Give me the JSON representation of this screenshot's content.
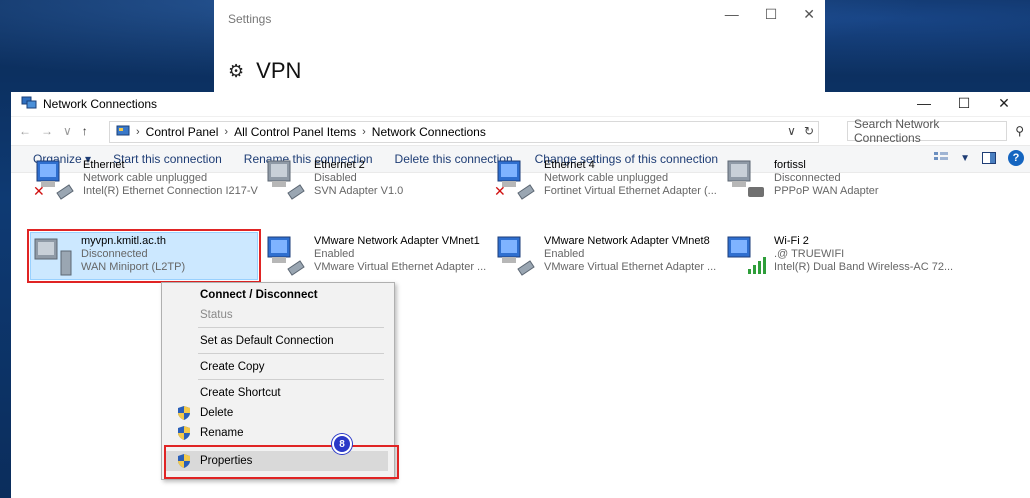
{
  "settings": {
    "title": "Settings",
    "heading": "VPN",
    "ctrl_min": "—",
    "ctrl_max": "☐",
    "ctrl_close": "✕"
  },
  "window": {
    "title": "Network Connections",
    "ctrl_min": "—",
    "ctrl_max": "☐",
    "ctrl_close": "✕"
  },
  "address": {
    "breadcrumbs": [
      "Control Panel",
      "All Control Panel Items",
      "Network Connections"
    ],
    "search_placeholder": "Search Network Connections"
  },
  "commands": {
    "organize": "Organize ▾",
    "start": "Start this connection",
    "rename": "Rename this connection",
    "delete": "Delete this connection",
    "change": "Change settings of this connection",
    "help": "?"
  },
  "connections": [
    {
      "name": "Ethernet",
      "status": "Network cable unplugged",
      "adapter": "Intel(R) Ethernet Connection I217-V"
    },
    {
      "name": "Ethernet 2",
      "status": "Disabled",
      "adapter": "SVN Adapter V1.0"
    },
    {
      "name": "Ethernet 4",
      "status": "Network cable unplugged",
      "adapter": "Fortinet Virtual Ethernet Adapter (..."
    },
    {
      "name": "fortissl",
      "status": "Disconnected",
      "adapter": "PPPoP WAN Adapter"
    },
    {
      "name": "myvpn.kmitl.ac.th",
      "status": "Disconnected",
      "adapter": "WAN Miniport (L2TP)"
    },
    {
      "name": "VMware Network Adapter VMnet1",
      "status": "Enabled",
      "adapter": "VMware Virtual Ethernet Adapter ..."
    },
    {
      "name": "VMware Network Adapter VMnet8",
      "status": "Enabled",
      "adapter": "VMware Virtual Ethernet Adapter ..."
    },
    {
      "name": "Wi-Fi 2",
      "status": ".@ TRUEWIFI",
      "adapter": "Intel(R) Dual Band Wireless-AC 72..."
    }
  ],
  "menu": {
    "connect": "Connect / Disconnect",
    "status": "Status",
    "default": "Set as Default Connection",
    "copy": "Create Copy",
    "shortcut": "Create Shortcut",
    "delete": "Delete",
    "rename": "Rename",
    "properties": "Properties"
  },
  "step_badge": "8",
  "colors": {
    "selection": "#cce8ff",
    "highlight_box": "#e02424",
    "badge": "#2b39c7",
    "command_text": "#1e3d75"
  }
}
